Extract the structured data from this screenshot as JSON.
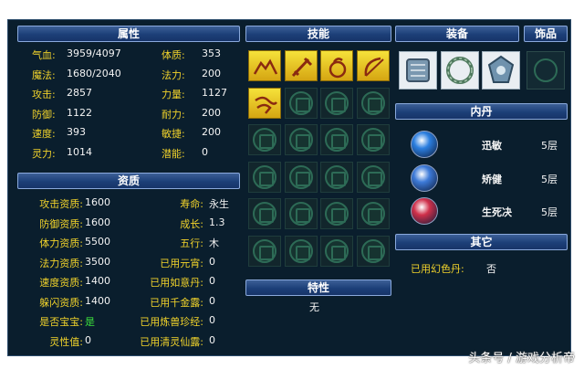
{
  "sections": {
    "attributes": "属性",
    "skills": "技能",
    "equipment": "装备",
    "ornament": "饰品",
    "aptitude": "资质",
    "inner_core": "内丹",
    "traits": "特性",
    "other": "其它"
  },
  "attributes": [
    {
      "label": "气血:",
      "value": "3959/4097",
      "label2": "体质:",
      "value2": "353"
    },
    {
      "label": "魔法:",
      "value": "1680/2040",
      "label2": "法力:",
      "value2": "200"
    },
    {
      "label": "攻击:",
      "value": "2857",
      "label2": "力量:",
      "value2": "1127"
    },
    {
      "label": "防御:",
      "value": "1122",
      "label2": "耐力:",
      "value2": "200"
    },
    {
      "label": "速度:",
      "value": "393",
      "label2": "敏捷:",
      "value2": "200"
    },
    {
      "label": "灵力:",
      "value": "1014",
      "label2": "潜能:",
      "value2": "0"
    }
  ],
  "aptitude": [
    {
      "label": "攻击资质:",
      "value": "1600",
      "label2": "寿命:",
      "value2": "永生"
    },
    {
      "label": "防御资质:",
      "value": "1600",
      "label2": "成长:",
      "value2": "1.3"
    },
    {
      "label": "体力资质:",
      "value": "5500",
      "label2": "五行:",
      "value2": "木"
    },
    {
      "label": "法力资质:",
      "value": "3500",
      "label2": "已用元宵:",
      "value2": "0"
    },
    {
      "label": "速度资质:",
      "value": "1400",
      "label2": "已用如意丹:",
      "value2": "0"
    },
    {
      "label": "躲闪资质:",
      "value": "1400",
      "label2": "已用千金露:",
      "value2": "0"
    },
    {
      "label": "是否宝宝:",
      "value": "是",
      "label2": "已用炼兽珍经:",
      "value2": "0"
    },
    {
      "label": "灵性值:",
      "value": "0",
      "label2": "已用清灵仙露:",
      "value2": "0"
    }
  ],
  "skills": [
    {
      "icon": "mountain-skill-icon"
    },
    {
      "icon": "sword-skill-icon"
    },
    {
      "icon": "gourd-skill-icon"
    },
    {
      "icon": "bow-skill-icon"
    },
    {
      "icon": "dragon-skill-icon"
    }
  ],
  "equipment": [
    {
      "icon": "armor-equip-icon"
    },
    {
      "icon": "ring-equip-icon"
    },
    {
      "icon": "amulet-equip-icon"
    }
  ],
  "inner_core": [
    {
      "name": "迅敏",
      "level": "5层",
      "color": "#2c7fe0"
    },
    {
      "name": "矫健",
      "level": "5层",
      "color": "#3d7ad8"
    },
    {
      "name": "生死决",
      "level": "5层",
      "color": "#d0304a"
    }
  ],
  "traits": {
    "value": "无"
  },
  "other": {
    "label": "已用幻色丹:",
    "value": "否"
  },
  "watermark": "头条号 / 游戏分析帝"
}
